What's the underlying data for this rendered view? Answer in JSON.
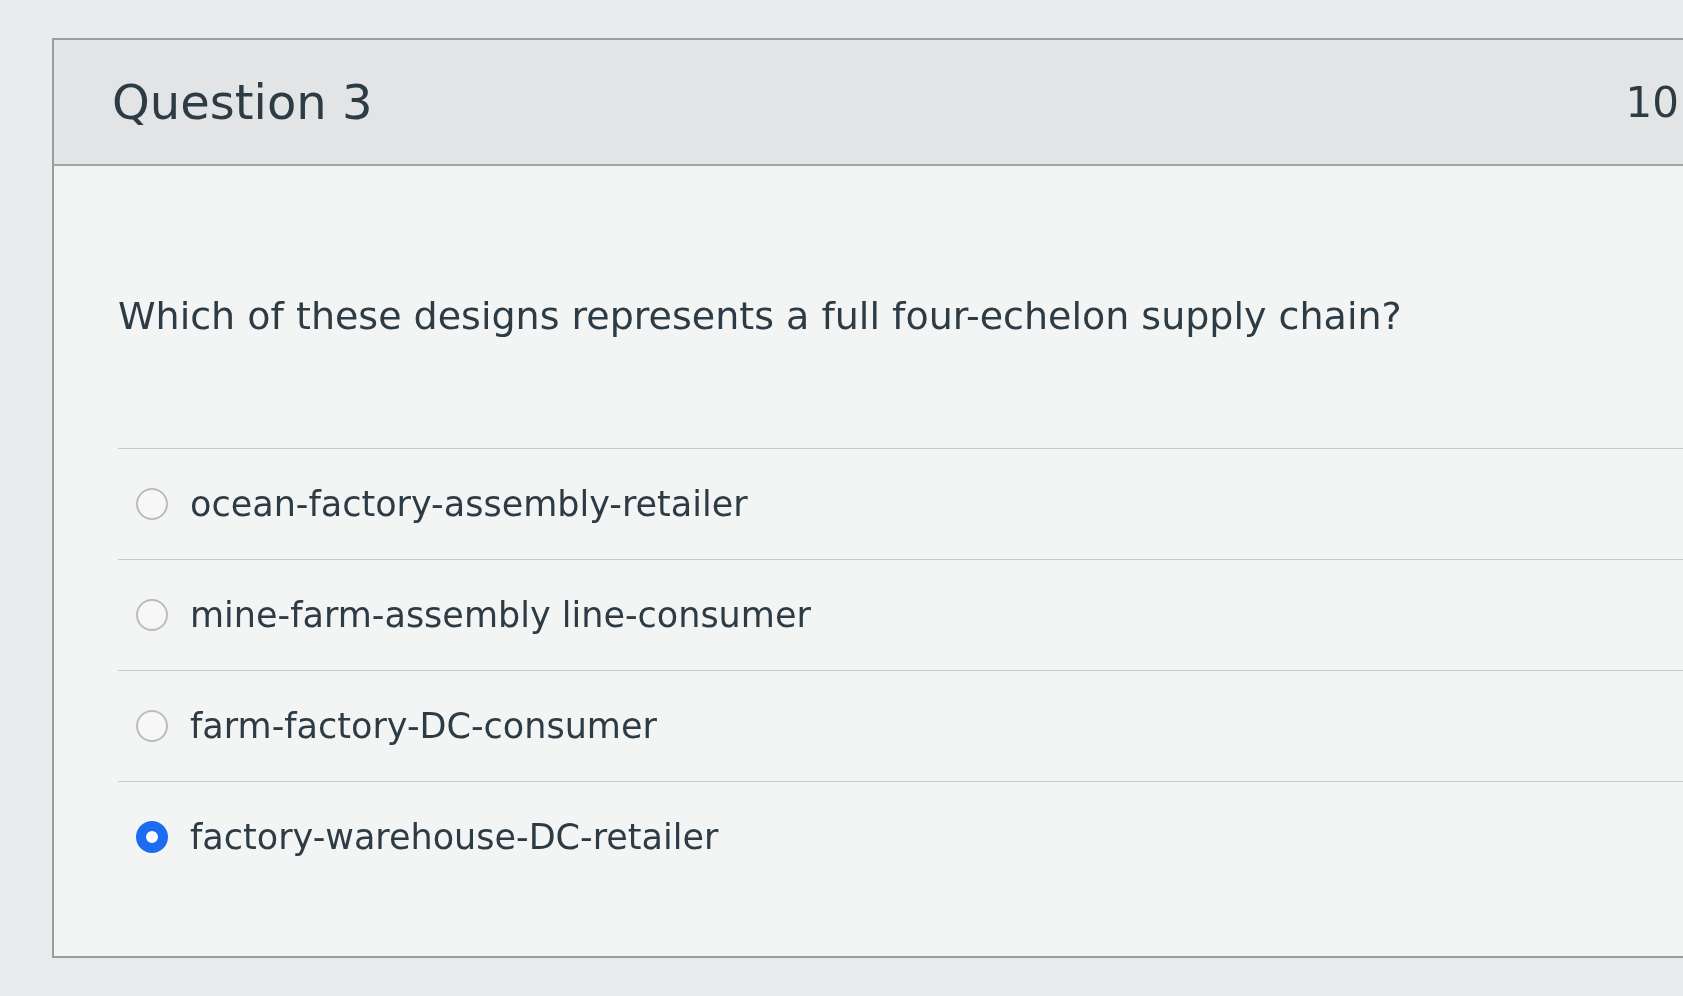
{
  "question": {
    "title": "Question 3",
    "points": "10",
    "text": "Which of these designs represents a full four-echelon supply chain?",
    "answers": [
      {
        "label": "ocean-factory-assembly-retailer",
        "selected": false
      },
      {
        "label": "mine-farm-assembly line-consumer",
        "selected": false
      },
      {
        "label": "farm-factory-DC-consumer",
        "selected": false
      },
      {
        "label": "factory-warehouse-DC-retailer",
        "selected": true
      }
    ]
  }
}
